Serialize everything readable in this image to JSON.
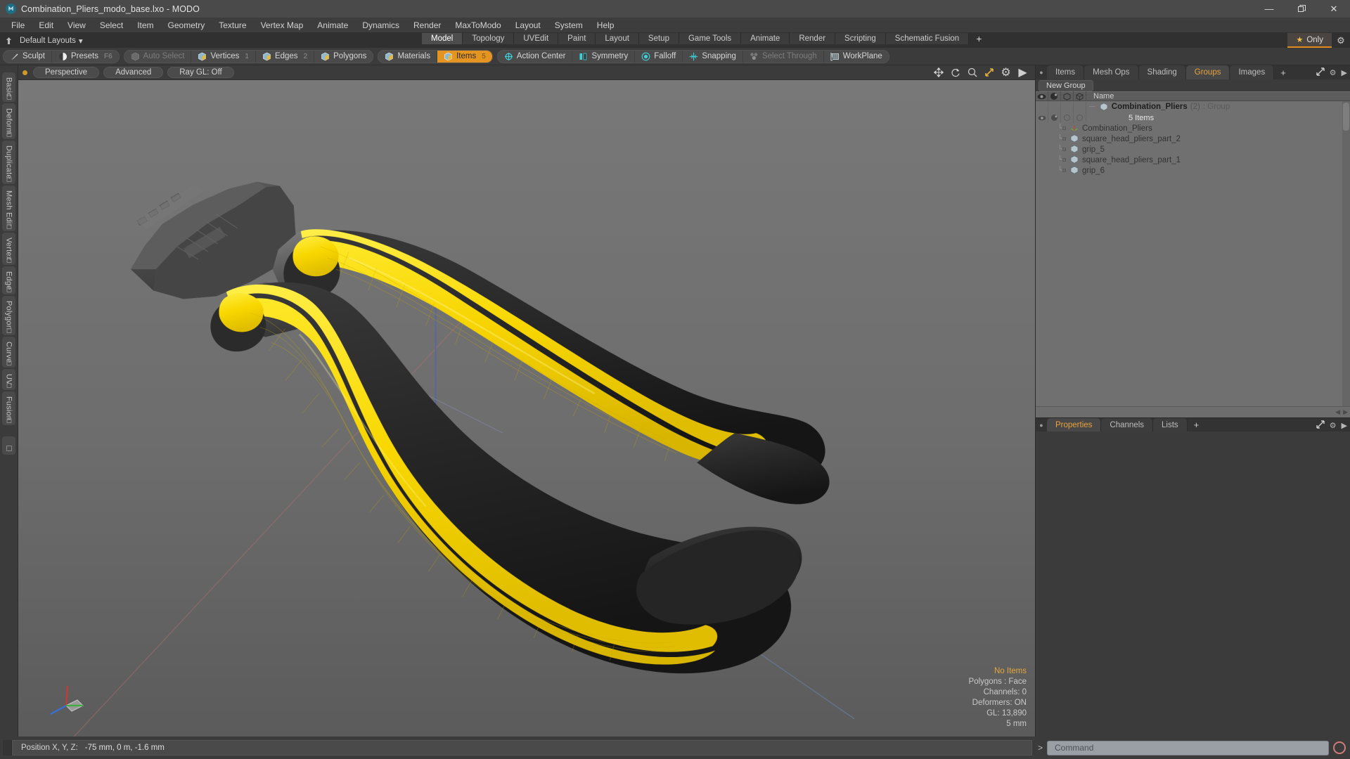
{
  "window": {
    "title": "Combination_Pliers_modo_base.lxo - MODO",
    "app_icon": "modo-logo-icon",
    "controls": {
      "minimize": "—",
      "maximize": "❐",
      "close": "✕"
    }
  },
  "menubar": {
    "items": [
      "File",
      "Edit",
      "View",
      "Select",
      "Item",
      "Geometry",
      "Texture",
      "Vertex Map",
      "Animate",
      "Dynamics",
      "Render",
      "MaxToModo",
      "Layout",
      "System",
      "Help"
    ]
  },
  "layoutbar": {
    "default_layouts_label": "Default Layouts",
    "chevron": "▾",
    "tabs": [
      {
        "label": "Model",
        "selected": true
      },
      {
        "label": "Topology",
        "selected": false
      },
      {
        "label": "UVEdit",
        "selected": false
      },
      {
        "label": "Paint",
        "selected": false
      },
      {
        "label": "Layout",
        "selected": false
      },
      {
        "label": "Setup",
        "selected": false
      },
      {
        "label": "Game Tools",
        "selected": false
      },
      {
        "label": "Animate",
        "selected": false
      },
      {
        "label": "Render",
        "selected": false
      },
      {
        "label": "Scripting",
        "selected": false
      },
      {
        "label": "Schematic Fusion",
        "selected": false
      }
    ],
    "add_tab_label": "+",
    "only_label": "Only",
    "only_accent": "#e08a1e",
    "gear_label": "⚙"
  },
  "modebar": {
    "group1": [
      {
        "label": "Sculpt",
        "icon": "sculpt-brush-icon",
        "state": "normal",
        "num": ""
      },
      {
        "label": "Presets",
        "icon": "presets-sphere-icon",
        "state": "normal",
        "num": "F6"
      }
    ],
    "group2": [
      {
        "label": "Auto Select",
        "icon": "cube-grey-icon",
        "state": "dim",
        "num": ""
      },
      {
        "label": "Vertices",
        "icon": "cube-vertices-icon",
        "state": "normal",
        "num": "1"
      },
      {
        "label": "Edges",
        "icon": "cube-edges-icon",
        "state": "normal",
        "num": "2"
      },
      {
        "label": "Polygons",
        "icon": "cube-polygons-icon",
        "state": "normal",
        "num": ""
      }
    ],
    "group3": [
      {
        "label": "Materials",
        "icon": "cube-materials-icon",
        "state": "normal",
        "num": ""
      },
      {
        "label": "Items",
        "icon": "cube-items-icon",
        "state": "active",
        "num": "5"
      }
    ],
    "group4": [
      {
        "label": "Action Center",
        "icon": "action-center-icon",
        "state": "normal",
        "num": ""
      },
      {
        "label": "Symmetry",
        "icon": "symmetry-icon",
        "state": "normal",
        "num": ""
      },
      {
        "label": "Falloff",
        "icon": "falloff-icon",
        "state": "normal",
        "num": ""
      },
      {
        "label": "Snapping",
        "icon": "snapping-icon",
        "state": "normal",
        "num": ""
      },
      {
        "label": "Select Through",
        "icon": "select-through-icon",
        "state": "dim",
        "num": ""
      },
      {
        "label": "WorkPlane",
        "icon": "workplane-icon",
        "state": "normal",
        "num": ""
      }
    ]
  },
  "leftrail": {
    "tabs": [
      "Basic",
      "Deform",
      "Duplicate",
      "Mesh Edit",
      "Vertex",
      "Edge",
      "Polygon",
      "Curve",
      "UV",
      "Fusion"
    ]
  },
  "viewport": {
    "header": {
      "view_mode": "Perspective",
      "shading": "Advanced",
      "raygl": "Ray GL: Off",
      "tools": [
        "move-icon",
        "rotate-icon",
        "zoom-icon",
        "maximize-icon",
        "gear-icon",
        "chevron-right-icon"
      ]
    },
    "stats": {
      "selection": "No Items",
      "polygons": "Polygons : Face",
      "channels": "Channels: 0",
      "deformers": "Deformers: ON",
      "gl": "GL: 13,890",
      "grid": "5 mm"
    },
    "model": {
      "name": "Combination Pliers",
      "handle_color": "#f5d800",
      "body_color": "#2d2d2d"
    }
  },
  "rightpanel": {
    "tabs": [
      {
        "label": "Items",
        "selected": false
      },
      {
        "label": "Mesh Ops",
        "selected": false
      },
      {
        "label": "Shading",
        "selected": false
      },
      {
        "label": "Groups",
        "selected": true
      },
      {
        "label": "Images",
        "selected": false
      }
    ],
    "add_tab": "+",
    "new_group_label": "New Group",
    "column_headers": {
      "visibility": "eye-icon",
      "render": "render-icon",
      "lock": "cube-outline-icon",
      "select": "cube-solid-icon",
      "name": "Name"
    },
    "group": {
      "name": "Combination_Pliers",
      "count": "(2)",
      "type": ": Group",
      "items_label": "5 Items",
      "children": [
        {
          "label": "Combination_Pliers",
          "icon": "locator-axis-icon"
        },
        {
          "label": "square_head_pliers_part_2",
          "icon": "mesh-cube-icon"
        },
        {
          "label": "grip_5",
          "icon": "mesh-cube-icon"
        },
        {
          "label": "square_head_pliers_part_1",
          "icon": "mesh-cube-icon"
        },
        {
          "label": "grip_6",
          "icon": "mesh-cube-icon"
        }
      ]
    },
    "properties_tabs": [
      {
        "label": "Properties",
        "selected": true
      },
      {
        "label": "Channels",
        "selected": false
      },
      {
        "label": "Lists",
        "selected": false
      }
    ],
    "properties_add_tab": "+"
  },
  "bottombar": {
    "position_label": "Position X, Y, Z:",
    "position_value": "-75 mm, 0 m, -1.6 mm",
    "command_caret": ">",
    "command_placeholder": "Command",
    "command_value": ""
  }
}
